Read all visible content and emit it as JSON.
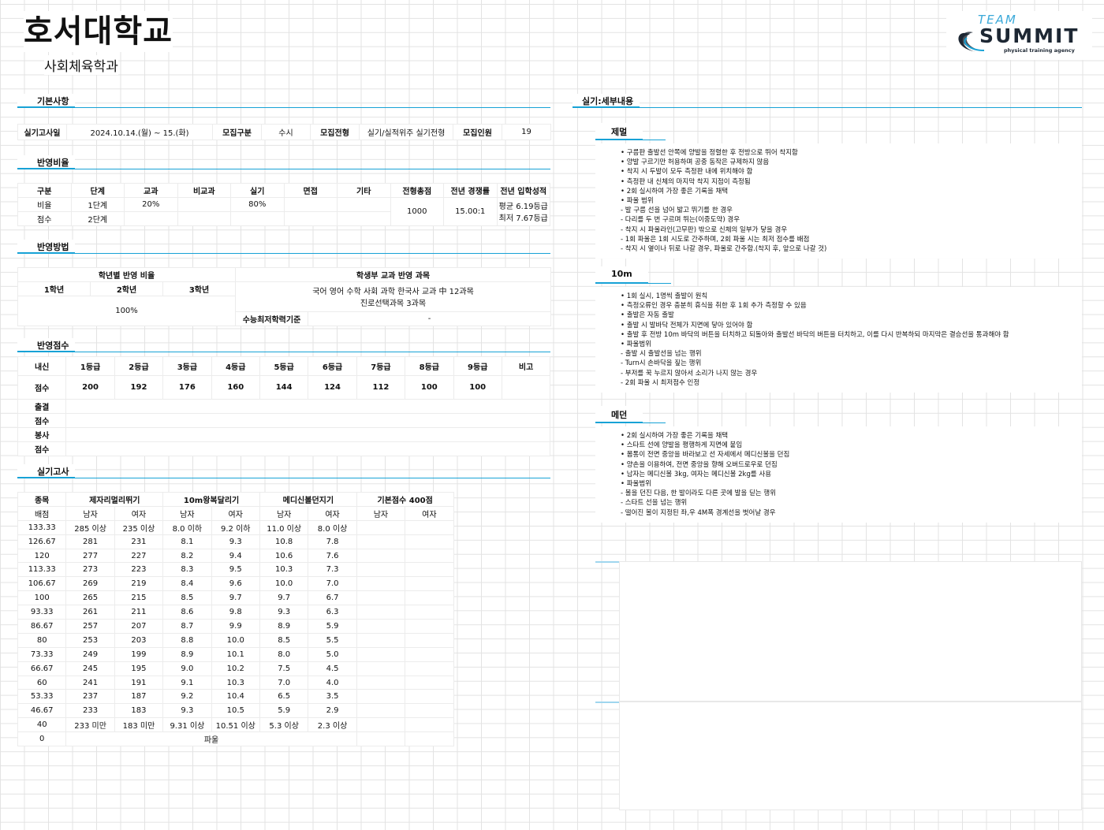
{
  "header": {
    "title": "호서대학교",
    "subtitle": "사회체육학과",
    "logo_top": "TEAM",
    "logo_main": "SUMMIT",
    "logo_sub": "physical training agency"
  },
  "basic": {
    "heading": "기본사항",
    "label_date": "실기고사일",
    "date": "2024.10.14.(월) ~ 15.(화)",
    "label_type": "모집구분",
    "type": "수시",
    "label_track": "모집전형",
    "track": "실기/실적위주 실기전형",
    "label_quota": "모집인원",
    "quota": "19"
  },
  "ratio": {
    "heading": "반영비율",
    "headers": [
      "구분",
      "단계",
      "교과",
      "비교과",
      "실기",
      "면접",
      "기타",
      "전형총점",
      "전년 경쟁률",
      "전년 입학성적"
    ],
    "rows": [
      [
        "비율",
        "1단계",
        "20%",
        "",
        "80%",
        "",
        ""
      ],
      [
        "점수",
        "2단계",
        "",
        "",
        "",
        "",
        ""
      ]
    ],
    "total": "1000",
    "competition": "15.00:1",
    "admit_avg": "평균 6.19등급",
    "admit_min": "최저 7.67등급"
  },
  "method": {
    "heading": "반영방법",
    "grade_title": "학년별 반영 비율",
    "grades": [
      "1학년",
      "2학년",
      "3학년"
    ],
    "grade_value": "100%",
    "subject_title": "학생부 교과 반영 과목",
    "subjects_line1": "국어 영어 수학 사회 과학 한국사 교과 中 12과목",
    "subjects_line2": "진로선택과목 3과목",
    "min_label": "수능최저학력기준",
    "min_value": "-"
  },
  "score": {
    "heading": "반영점수",
    "headers": [
      "내신",
      "1등급",
      "2등급",
      "3등급",
      "4등급",
      "5등급",
      "6등급",
      "7등급",
      "8등급",
      "9등급",
      "비고"
    ],
    "row_label": "점수",
    "values": [
      "200",
      "192",
      "176",
      "160",
      "144",
      "124",
      "112",
      "100",
      "100",
      ""
    ],
    "extra_rows": [
      "출결",
      "점수",
      "봉사",
      "점수"
    ]
  },
  "practical": {
    "heading": "실기고사",
    "headers": [
      "종목",
      "제자리멀리뛰기",
      "10m왕복달리기",
      "메디신볼던지기",
      "기본점수 400점"
    ],
    "sub_headers": [
      "배점",
      "남자",
      "여자",
      "남자",
      "여자",
      "남자",
      "여자",
      "남자",
      "여자"
    ],
    "rows": [
      [
        "133.33",
        "285 이상",
        "235 이상",
        "8.0 이하",
        "9.2 이하",
        "11.0 이상",
        "8.0 이상"
      ],
      [
        "126.67",
        "281",
        "231",
        "8.1",
        "9.3",
        "10.8",
        "7.8"
      ],
      [
        "120",
        "277",
        "227",
        "8.2",
        "9.4",
        "10.6",
        "7.6"
      ],
      [
        "113.33",
        "273",
        "223",
        "8.3",
        "9.5",
        "10.3",
        "7.3"
      ],
      [
        "106.67",
        "269",
        "219",
        "8.4",
        "9.6",
        "10.0",
        "7.0"
      ],
      [
        "100",
        "265",
        "215",
        "8.5",
        "9.7",
        "9.7",
        "6.7"
      ],
      [
        "93.33",
        "261",
        "211",
        "8.6",
        "9.8",
        "9.3",
        "6.3"
      ],
      [
        "86.67",
        "257",
        "207",
        "8.7",
        "9.9",
        "8.9",
        "5.9"
      ],
      [
        "80",
        "253",
        "203",
        "8.8",
        "10.0",
        "8.5",
        "5.5"
      ],
      [
        "73.33",
        "249",
        "199",
        "8.9",
        "10.1",
        "8.0",
        "5.0"
      ],
      [
        "66.67",
        "245",
        "195",
        "9.0",
        "10.2",
        "7.5",
        "4.5"
      ],
      [
        "60",
        "241",
        "191",
        "9.1",
        "10.3",
        "7.0",
        "4.0"
      ],
      [
        "53.33",
        "237",
        "187",
        "9.2",
        "10.4",
        "6.5",
        "3.5"
      ],
      [
        "46.67",
        "233",
        "183",
        "9.3",
        "10.5",
        "5.9",
        "2.9"
      ],
      [
        "40",
        "233 미만",
        "183 미만",
        "9.31 이상",
        "10.51 이상",
        "5.3 이상",
        "2.3 이상"
      ]
    ],
    "zero_label": "0",
    "foul": "파울"
  },
  "detail": {
    "heading": "실기:세부내용",
    "sections": [
      {
        "title": "제멀",
        "items": [
          "• 구름판 출발선 안쪽에 양발을 정렬한 후 전방으로 뛰어 착지함",
          "• 양발 구르기만 허용하며 공중 동작은 규제하지 않음",
          "• 착지 시 두발이 모두 측정판 내에 위치해야 함",
          "• 측정판 내 신체의 마지막 착지 지점이 측정됨",
          "• 2회 실시하여 가장 좋은 기록을 채택",
          "• 파울 범위",
          "- 발 구름 선을 넘어 밟고 뛰기를 한 경우",
          "- 다리를 두 번 구르며 뛰는(이중도약) 경우",
          "- 착지 시 파울라인(고무판) 밖으로 신체의 일부가 닿을 경우",
          "- 1회 파울은 1회 시도로 간주하며, 2회 파울 시는 최저 점수를 배점",
          "- 착지 시 옆이나 뒤로 나갈 경우, 파울로 간주함.(착지 후, 앞으로 나갈 것)"
        ]
      },
      {
        "title": "10m",
        "items": [
          "• 1회 실시, 1명씩 출발이 원칙",
          "• 측정오류인 경우 충분히 휴식을 취한 후 1회 추가 측정할 수 있음",
          "• 출발은 자동 출발",
          "• 출발 시 발바닥 전체가 지면에 닿아 있어야 함",
          "• 출발 후 전방 10m 바닥의 버튼을 터치하고 되돌아와 출발선 바닥의 버튼을 터치하고, 이를 다시 반복하되 마지막은 결승선을 통과해야 함",
          "• 파울범위",
          "- 출발 시 출발선을 넘는 행위",
          "- Turn시 손바닥을 짚는 행위",
          "- 부저를 꾹 누르지 않아서 소리가 나지 않는 경우",
          "- 2회 파울 시 최저점수 인정"
        ]
      },
      {
        "title": "메던",
        "items": [
          "• 2회 실시하여 가장 좋은 기록을 채택",
          "• 스타트 선에 양발을 평행하게 지면에 붙임",
          "• 몸통이 전면 중앙을 바라보고 선 자세에서 메디신볼을 던짐",
          "• 양손을 이용하여, 전면 중앙을 향해 오버드로우로 던짐",
          "• 남자는 메디신볼 3kg, 여자는 메디신볼 2kg를 사용",
          "• 파울범위",
          "- 볼을 던진 다음, 한 발이라도 다른 곳에 발을 딛는 행위",
          "- 스타트 선을 넘는 행위",
          "- 떨어진 볼이 지정된 좌,우 4M폭 경계선을 벗어날 경우"
        ]
      }
    ]
  },
  "colors": {
    "accent": "#17a2d6",
    "accent_light": "#9fd6ee",
    "grid": "#e3e3e3"
  }
}
